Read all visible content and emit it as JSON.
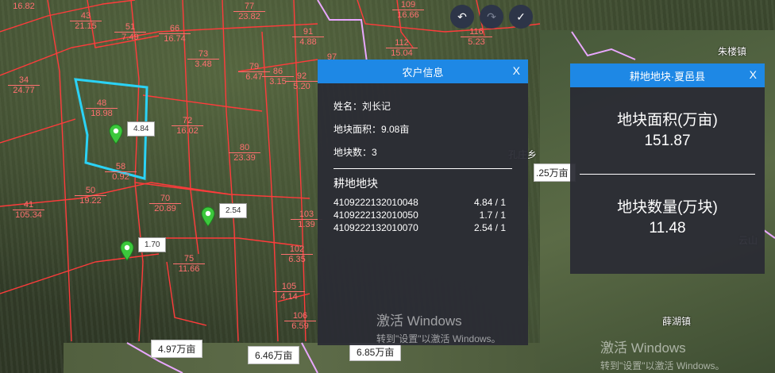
{
  "map": {
    "parcels": [
      {
        "n": "",
        "a": "16.82"
      },
      {
        "n": "43",
        "a": "21.15"
      },
      {
        "n": "51",
        "a": "7.49"
      },
      {
        "n": "66",
        "a": "16.74"
      },
      {
        "n": "73",
        "a": "3.48"
      },
      {
        "n": "77",
        "a": "23.82"
      },
      {
        "n": "91",
        "a": "4.88"
      },
      {
        "n": "97",
        "a": ""
      },
      {
        "n": "34",
        "a": "24.77"
      },
      {
        "n": "48",
        "a": "18.98"
      },
      {
        "n": "79",
        "a": "6.47"
      },
      {
        "n": "86",
        "a": "3.15"
      },
      {
        "n": "92",
        "a": "5.20"
      },
      {
        "n": "72",
        "a": "16.02"
      },
      {
        "n": "80",
        "a": "23.39"
      },
      {
        "n": "58",
        "a": "0.92"
      },
      {
        "n": "50",
        "a": "19.22"
      },
      {
        "n": "41",
        "a": "105.34"
      },
      {
        "n": "70",
        "a": "20.89"
      },
      {
        "n": "103",
        "a": "1.39"
      },
      {
        "n": "102",
        "a": "6.35"
      },
      {
        "n": "75",
        "a": "11.66"
      },
      {
        "n": "105",
        "a": "4.14"
      },
      {
        "n": "106",
        "a": "6.59"
      },
      {
        "n": "109",
        "a": "16.66"
      },
      {
        "n": "112",
        "a": "15.04"
      },
      {
        "n": "116",
        "a": "5.23"
      }
    ],
    "markers": [
      {
        "label": "4.84"
      },
      {
        "label": "2.54"
      },
      {
        "label": "1.70"
      }
    ],
    "area_tags": [
      "4.97万亩",
      "6.46万亩",
      "6.85万亩",
      ".25万亩"
    ],
    "places": [
      "朱楼镇",
      "薛湖镇",
      "孔庄乡",
      "云山"
    ]
  },
  "toolbar": {
    "undo": "↶",
    "redo": "↷",
    "confirm": "✓"
  },
  "farmer_panel": {
    "title": "农户信息",
    "close": "X",
    "name": "姓名：刘长记",
    "area": "地块面积：9.08亩",
    "count": "地块数：3",
    "section_title": "耕地地块",
    "plots": [
      {
        "id": "4109222132010048",
        "value": "4.84 / 1"
      },
      {
        "id": "4109222132010050",
        "value": "1.7 / 1"
      },
      {
        "id": "4109222132010070",
        "value": "2.54 / 1"
      }
    ]
  },
  "county_panel": {
    "title": "耕地地块·夏邑县",
    "close": "X",
    "area_label": "地块面积(万亩)",
    "area_value": "151.87",
    "count_label": "地块数量(万块)",
    "count_value": "11.48"
  },
  "watermarks": [
    {
      "t1": "激活 Windows",
      "t2": "转到\"设置\"以激活 Windows。"
    },
    {
      "t1": "激活 Windows",
      "t2": "转到\"设置\"以激活 Windows。"
    }
  ],
  "colors": {
    "accent": "#1e88e5",
    "parcel_line": "#ff4040",
    "selected_parcel": "#29c7f0",
    "marker": "#3cc83c"
  }
}
